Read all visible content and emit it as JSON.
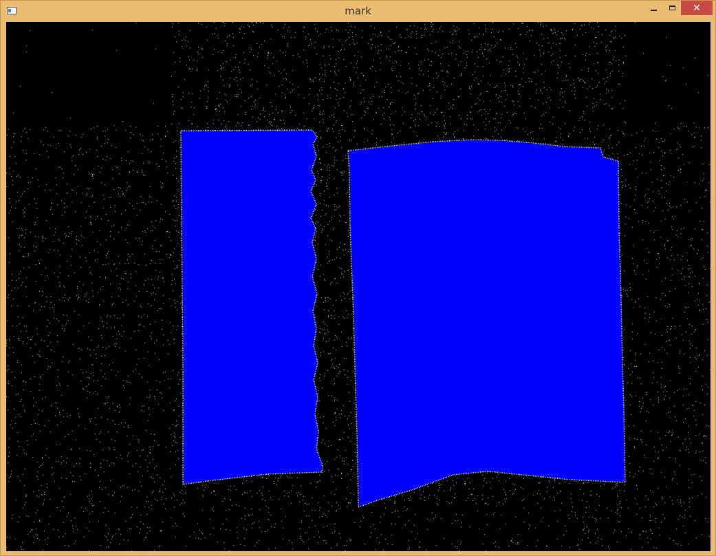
{
  "window": {
    "title": "mark",
    "close_glyph": "✕",
    "icons": [
      "app-window-icon",
      "minimize-icon",
      "maximize-icon",
      "close-icon"
    ]
  },
  "canvas": {
    "background_color": "#000000",
    "noise_color": "#e8e8c8",
    "segment_fill_color": "#0000ff",
    "segment_outline_color": "#ffff66",
    "segment_count": 2
  }
}
